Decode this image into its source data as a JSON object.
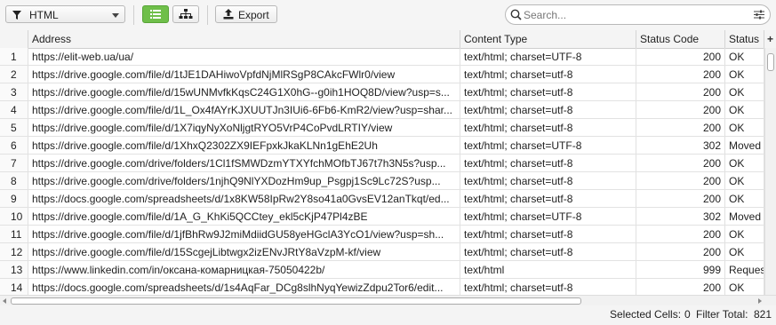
{
  "toolbar": {
    "filter_value": "HTML",
    "export_label": "Export",
    "search_placeholder": "Search..."
  },
  "columns": [
    "Address",
    "Content Type",
    "Status Code",
    "Status"
  ],
  "rows": [
    {
      "n": "1",
      "address": "https://elit-web.ua/ua/",
      "type": "text/html; charset=UTF-8",
      "code": "200",
      "status": "OK"
    },
    {
      "n": "2",
      "address": "https://drive.google.com/file/d/1tJE1DAHiwoVpfdNjMlRSgP8CAkcFWlr0/view",
      "type": "text/html; charset=utf-8",
      "code": "200",
      "status": "OK"
    },
    {
      "n": "3",
      "address": "https://drive.google.com/file/d/15wUNMvfkKqsC24G1X0hG--g0ih1HOQ8D/view?usp=s...",
      "type": "text/html; charset=utf-8",
      "code": "200",
      "status": "OK"
    },
    {
      "n": "4",
      "address": "https://drive.google.com/file/d/1L_Ox4fAYrKJXUUTJn3IUi6-6Fb6-KmR2/view?usp=shar...",
      "type": "text/html; charset=utf-8",
      "code": "200",
      "status": "OK"
    },
    {
      "n": "5",
      "address": "https://drive.google.com/file/d/1X7iqyNyXoNljgtRYO5VrP4CoPvdLRTIY/view",
      "type": "text/html; charset=utf-8",
      "code": "200",
      "status": "OK"
    },
    {
      "n": "6",
      "address": "https://drive.google.com/file/d/1XhxQ2302ZX9IEFpxkJkaKLNn1gEhE2Uh",
      "type": "text/html; charset=UTF-8",
      "code": "302",
      "status": "Moved"
    },
    {
      "n": "7",
      "address": "https://drive.google.com/drive/folders/1Cl1fSMWDzmYTXYfchMOfbTJ67t7h3N5s?usp...",
      "type": "text/html; charset=utf-8",
      "code": "200",
      "status": "OK"
    },
    {
      "n": "8",
      "address": "https://drive.google.com/drive/folders/1njhQ9NlYXDozHm9up_Psgpj1Sc9Lc72S?usp...",
      "type": "text/html; charset=utf-8",
      "code": "200",
      "status": "OK"
    },
    {
      "n": "9",
      "address": "https://docs.google.com/spreadsheets/d/1x8KW58IpRw2Y8so41a0GvsEV12anTkqt/ed...",
      "type": "text/html; charset=utf-8",
      "code": "200",
      "status": "OK"
    },
    {
      "n": "10",
      "address": "https://drive.google.com/file/d/1A_G_KhKi5QCCtey_ekl5cKjP47Pl4zBE",
      "type": "text/html; charset=UTF-8",
      "code": "302",
      "status": "Moved"
    },
    {
      "n": "11",
      "address": "https://drive.google.com/file/d/1jfBhRw9J2miMdiidGU58yeHGclA3YcO1/view?usp=sh...",
      "type": "text/html; charset=utf-8",
      "code": "200",
      "status": "OK"
    },
    {
      "n": "12",
      "address": "https://drive.google.com/file/d/15ScgejLibtwgx2izENvJRtY8aVzpM-kf/view",
      "type": "text/html; charset=utf-8",
      "code": "200",
      "status": "OK"
    },
    {
      "n": "13",
      "address": "https://www.linkedin.com/in/оксана-комарницкая-75050422b/",
      "type": "text/html",
      "code": "999",
      "status": "Reques"
    },
    {
      "n": "14",
      "address": "https://docs.google.com/spreadsheets/d/1s4AqFar_DCg8slhNyqYewizZdpu2Tor6/edit...",
      "type": "text/html; charset=utf-8",
      "code": "200",
      "status": "OK"
    }
  ],
  "statusbar": {
    "selected_label": "Selected Cells:",
    "selected_value": "0",
    "filter_label": "Filter Total:",
    "filter_value": "821"
  },
  "colors": {
    "accent": "#6fbf4a"
  }
}
